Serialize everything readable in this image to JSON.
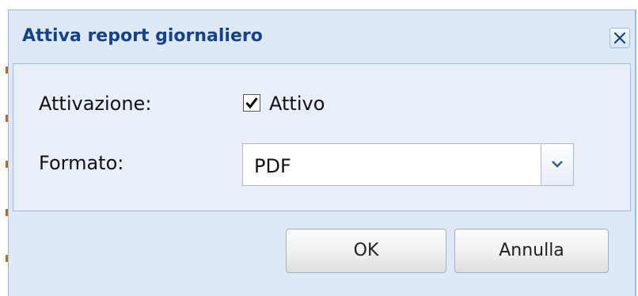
{
  "dialog": {
    "title": "Attiva report giornaliero",
    "close_icon": "close-icon"
  },
  "form": {
    "activation_label": "Attivazione:",
    "activation_checked": true,
    "activation_checkbox_label": "Attivo",
    "format_label": "Formato:",
    "format_value": "PDF",
    "dropdown_icon": "chevron-down-icon"
  },
  "buttons": {
    "ok_label": "OK",
    "cancel_label": "Annulla"
  },
  "colors": {
    "title_text": "#15428b",
    "dialog_background": "#dfe8f6",
    "panel_background": "#e8eff9",
    "border": "#99bbe8"
  }
}
